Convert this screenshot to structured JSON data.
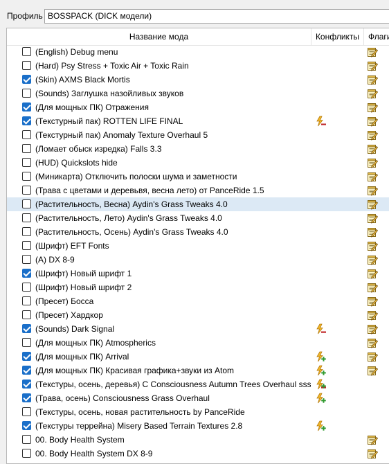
{
  "profile": {
    "label": "Профиль",
    "value": "BOSSPACK (DICK модели)"
  },
  "columns": {
    "name": "Название мода",
    "conflicts": "Конфликты",
    "flags": "Флаги"
  },
  "mods": [
    {
      "name": "(English) Debug menu",
      "checked": false,
      "conflict": "",
      "flag": true,
      "selected": false
    },
    {
      "name": "(Hard) Psy Stress + Toxic Air + Toxic Rain",
      "checked": false,
      "conflict": "",
      "flag": true,
      "selected": false
    },
    {
      "name": "(Skin) AXMS Black Mortis",
      "checked": true,
      "conflict": "",
      "flag": true,
      "selected": false
    },
    {
      "name": "(Sounds) Заглушка назойливых звуков",
      "checked": false,
      "conflict": "",
      "flag": true,
      "selected": false
    },
    {
      "name": "(Для мощных ПК) Отражения",
      "checked": true,
      "conflict": "",
      "flag": true,
      "selected": false
    },
    {
      "name": "(Текстурный пак) ROTTEN LIFE FINAL",
      "checked": true,
      "conflict": "minus",
      "flag": true,
      "selected": false
    },
    {
      "name": "(Текстурный пак) Anomaly Texture Overhaul 5",
      "checked": false,
      "conflict": "",
      "flag": true,
      "selected": false
    },
    {
      "name": "(Ломает обыск изредка) Falls 3.3",
      "checked": false,
      "conflict": "",
      "flag": true,
      "selected": false
    },
    {
      "name": "(HUD) Quickslots hide",
      "checked": false,
      "conflict": "",
      "flag": true,
      "selected": false
    },
    {
      "name": "(Миникарта) Отключить полоски шума и заметности",
      "checked": false,
      "conflict": "",
      "flag": true,
      "selected": false
    },
    {
      "name": "(Трава с цветами и деревьвя, весна лето) от PanceRide 1.5",
      "checked": false,
      "conflict": "",
      "flag": true,
      "selected": false
    },
    {
      "name": "(Растительность, Весна) Aydin's Grass Tweaks 4.0",
      "checked": false,
      "conflict": "",
      "flag": true,
      "selected": true
    },
    {
      "name": "(Растительность, Лето) Aydin's Grass Tweaks 4.0",
      "checked": false,
      "conflict": "",
      "flag": true,
      "selected": false
    },
    {
      "name": "(Растительность, Осень) Aydin's Grass Tweaks 4.0",
      "checked": false,
      "conflict": "",
      "flag": true,
      "selected": false
    },
    {
      "name": "(Шрифт) EFT Fonts",
      "checked": false,
      "conflict": "",
      "flag": true,
      "selected": false
    },
    {
      "name": "(A) DX 8-9",
      "checked": false,
      "conflict": "",
      "flag": true,
      "selected": false
    },
    {
      "name": "(Шрифт) Новый шрифт 1",
      "checked": true,
      "conflict": "",
      "flag": true,
      "selected": false
    },
    {
      "name": "(Шрифт) Новый шрифт 2",
      "checked": false,
      "conflict": "",
      "flag": true,
      "selected": false
    },
    {
      "name": "(Пресет) Босса",
      "checked": false,
      "conflict": "",
      "flag": true,
      "selected": false
    },
    {
      "name": "(Пресет) Хардкор",
      "checked": false,
      "conflict": "",
      "flag": true,
      "selected": false
    },
    {
      "name": "(Sounds) Dark Signal",
      "checked": true,
      "conflict": "minus",
      "flag": true,
      "selected": false
    },
    {
      "name": "(Для мощных ПК) Atmospherics",
      "checked": false,
      "conflict": "",
      "flag": true,
      "selected": false
    },
    {
      "name": "(Для мощных ПК) Arrival",
      "checked": true,
      "conflict": "plus",
      "flag": true,
      "selected": false
    },
    {
      "name": "(Для мощных ПК) Красивая графика+звуки из Atom",
      "checked": true,
      "conflict": "plus",
      "flag": true,
      "selected": false
    },
    {
      "name": "(Текстуры, осень, деревья) C Consciousness Autumn Trees Overhaul sss...",
      "checked": true,
      "conflict": "both",
      "flag": false,
      "selected": false
    },
    {
      "name": "(Трава, осень) Consciousness Grass Overhaul",
      "checked": true,
      "conflict": "plus",
      "flag": false,
      "selected": false
    },
    {
      "name": "(Текстуры, осень, новая растительность by PanceRide",
      "checked": false,
      "conflict": "",
      "flag": false,
      "selected": false
    },
    {
      "name": "(Текстуры террейна) Misery Based Terrain Textures 2.8",
      "checked": true,
      "conflict": "plus",
      "flag": false,
      "selected": false
    },
    {
      "name": "00. Body Health System",
      "checked": false,
      "conflict": "",
      "flag": true,
      "selected": false
    },
    {
      "name": "00. Body Health System DX 8-9",
      "checked": false,
      "conflict": "",
      "flag": true,
      "selected": false
    }
  ]
}
